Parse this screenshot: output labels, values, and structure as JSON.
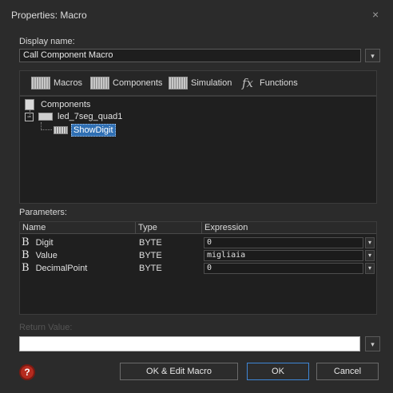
{
  "window": {
    "title": "Properties: Macro"
  },
  "display_name": {
    "label": "Display name:",
    "value": "Call Component Macro"
  },
  "tabs": [
    {
      "label": "Macros",
      "icon": "macros-icon"
    },
    {
      "label": "Components",
      "icon": "components-icon"
    },
    {
      "label": "Simulation",
      "icon": "simulation-icon"
    },
    {
      "label": "Functions",
      "icon": "fx-icon",
      "icon_text": "fx"
    }
  ],
  "tree": {
    "root": "Components",
    "component": "led_7seg_quad1",
    "expander": "−",
    "macro": "ShowDigit"
  },
  "parameters": {
    "label": "Parameters:",
    "columns": [
      "Name",
      "Type",
      "Expression"
    ],
    "rows": [
      {
        "icon": "B",
        "name": "Digit",
        "type": "BYTE",
        "expression": "0"
      },
      {
        "icon": "B",
        "name": "Value",
        "type": "BYTE",
        "expression": "migliaia"
      },
      {
        "icon": "B",
        "name": "DecimalPoint",
        "type": "BYTE",
        "expression": "0"
      }
    ]
  },
  "return_value": {
    "label": "Return Value:",
    "value": ""
  },
  "buttons": {
    "help": "?",
    "ok_edit": "OK & Edit Macro",
    "ok": "OK",
    "cancel": "Cancel"
  },
  "glyphs": {
    "close": "×",
    "dropdown": "▾"
  }
}
